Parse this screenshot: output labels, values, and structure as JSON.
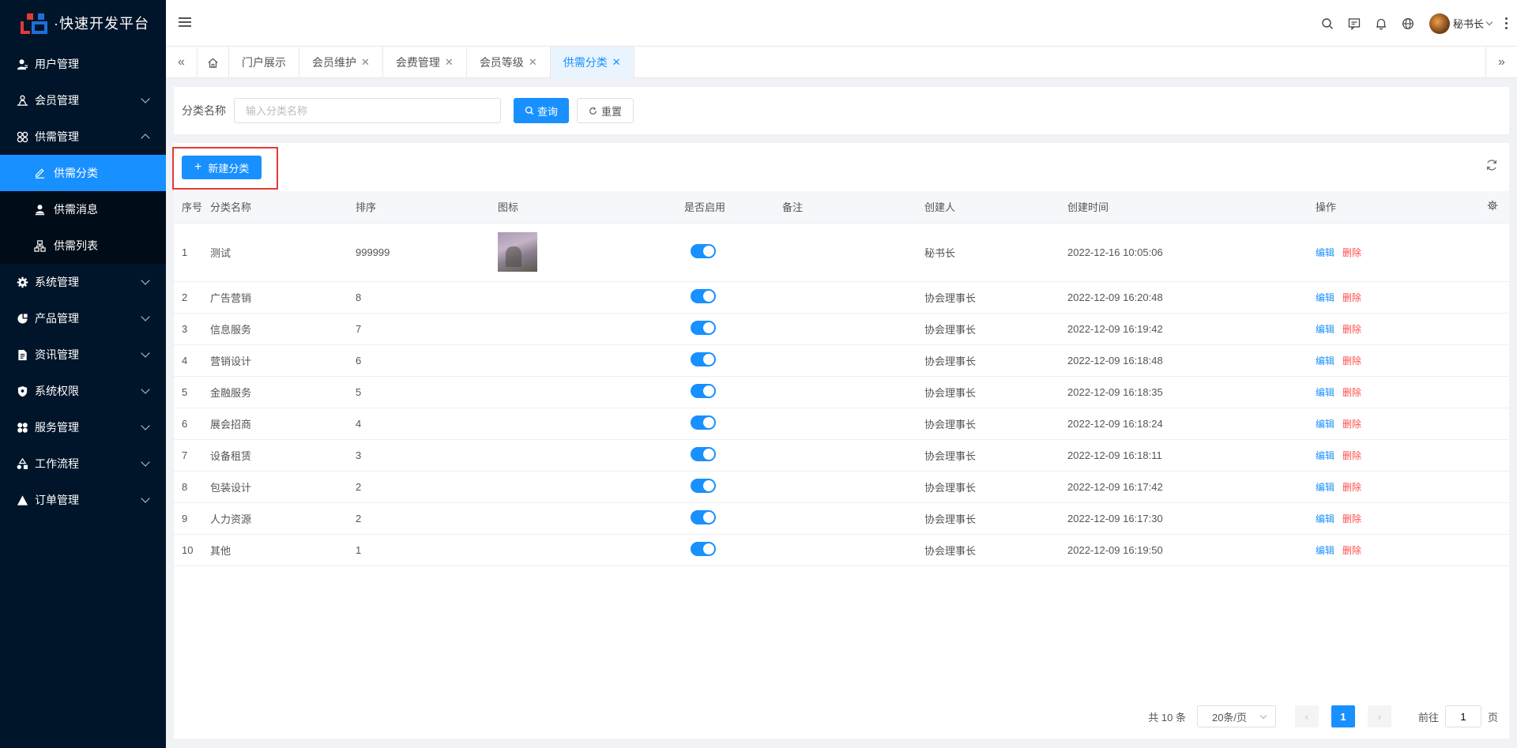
{
  "brand": {
    "title": "·快速开发平台"
  },
  "sidebar": {
    "items": [
      {
        "label": "用户管理",
        "icon": "user-icon",
        "expandable": false
      },
      {
        "label": "会员管理",
        "icon": "members-icon",
        "expandable": true
      },
      {
        "label": "供需管理",
        "icon": "supply-demand-icon",
        "expandable": true,
        "expanded": true,
        "children": [
          {
            "label": "供需分类",
            "icon": "edit-icon",
            "active": true
          },
          {
            "label": "供需消息",
            "icon": "user-stamp-icon",
            "active": false
          },
          {
            "label": "供需列表",
            "icon": "tree-icon",
            "active": false
          }
        ]
      },
      {
        "label": "系统管理",
        "icon": "gear-icon",
        "expandable": true
      },
      {
        "label": "产品管理",
        "icon": "product-icon",
        "expandable": true
      },
      {
        "label": "资讯管理",
        "icon": "document-icon",
        "expandable": true
      },
      {
        "label": "系统权限",
        "icon": "shield-icon",
        "expandable": true
      },
      {
        "label": "服务管理",
        "icon": "service-icon",
        "expandable": true
      },
      {
        "label": "工作流程",
        "icon": "workflow-icon",
        "expandable": true
      },
      {
        "label": "订单管理",
        "icon": "triangle-icon",
        "expandable": true
      }
    ]
  },
  "header": {
    "username": "秘书长",
    "icons": [
      "search-icon",
      "message-icon",
      "bell-icon",
      "globe-icon"
    ]
  },
  "tabs": [
    {
      "label": "门户展示",
      "closable": false,
      "active": false
    },
    {
      "label": "会员维护",
      "closable": true,
      "active": false
    },
    {
      "label": "会费管理",
      "closable": true,
      "active": false
    },
    {
      "label": "会员等级",
      "closable": true,
      "active": false
    },
    {
      "label": "供需分类",
      "closable": true,
      "active": true
    }
  ],
  "search": {
    "label": "分类名称",
    "placeholder": "输入分类名称",
    "value": "",
    "query_label": "查询",
    "reset_label": "重置"
  },
  "toolbar": {
    "new_label": "新建分类"
  },
  "table": {
    "columns": [
      "序号",
      "分类名称",
      "排序",
      "图标",
      "是否启用",
      "备注",
      "创建人",
      "创建时间",
      "操作"
    ],
    "edit_label": "编辑",
    "delete_label": "删除",
    "rows": [
      {
        "no": "1",
        "name": "测试",
        "sort": "999999",
        "has_icon": true,
        "enabled": true,
        "remark": "",
        "creator": "秘书长",
        "created": "2022-12-16 10:05:06"
      },
      {
        "no": "2",
        "name": "广告营销",
        "sort": "8",
        "has_icon": false,
        "enabled": true,
        "remark": "",
        "creator": "协会理事长",
        "created": "2022-12-09 16:20:48"
      },
      {
        "no": "3",
        "name": "信息服务",
        "sort": "7",
        "has_icon": false,
        "enabled": true,
        "remark": "",
        "creator": "协会理事长",
        "created": "2022-12-09 16:19:42"
      },
      {
        "no": "4",
        "name": "营销设计",
        "sort": "6",
        "has_icon": false,
        "enabled": true,
        "remark": "",
        "creator": "协会理事长",
        "created": "2022-12-09 16:18:48"
      },
      {
        "no": "5",
        "name": "金融服务",
        "sort": "5",
        "has_icon": false,
        "enabled": true,
        "remark": "",
        "creator": "协会理事长",
        "created": "2022-12-09 16:18:35"
      },
      {
        "no": "6",
        "name": "展会招商",
        "sort": "4",
        "has_icon": false,
        "enabled": true,
        "remark": "",
        "creator": "协会理事长",
        "created": "2022-12-09 16:18:24"
      },
      {
        "no": "7",
        "name": "设备租赁",
        "sort": "3",
        "has_icon": false,
        "enabled": true,
        "remark": "",
        "creator": "协会理事长",
        "created": "2022-12-09 16:18:11"
      },
      {
        "no": "8",
        "name": "包装设计",
        "sort": "2",
        "has_icon": false,
        "enabled": true,
        "remark": "",
        "creator": "协会理事长",
        "created": "2022-12-09 16:17:42"
      },
      {
        "no": "9",
        "name": "人力资源",
        "sort": "2",
        "has_icon": false,
        "enabled": true,
        "remark": "",
        "creator": "协会理事长",
        "created": "2022-12-09 16:17:30"
      },
      {
        "no": "10",
        "name": "其他",
        "sort": "1",
        "has_icon": false,
        "enabled": true,
        "remark": "",
        "creator": "协会理事长",
        "created": "2022-12-09 16:19:50"
      }
    ]
  },
  "pagination": {
    "total_text": "共 10 条",
    "page_size": "20条/页",
    "current_page": "1",
    "goto_label": "前往",
    "goto_value": "1",
    "page_suffix": "页"
  },
  "colors": {
    "primary": "#1890ff",
    "sidebar_bg": "#001529",
    "danger": "#ff4d4f",
    "highlight": "#e53935"
  }
}
